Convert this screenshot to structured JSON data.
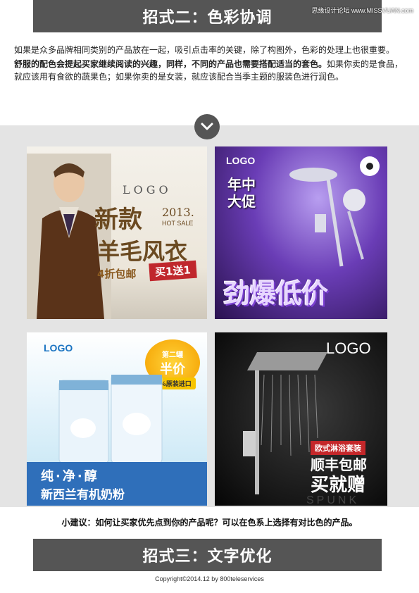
{
  "header": {
    "title": "招式二：色彩协调",
    "watermark": "思缘设计论坛 www.MISSVUAN.com"
  },
  "intro": {
    "para1": "如果是众多品牌相同类别的产品放在一起，吸引点击率的关键，除了构图外，色彩的处理上也很重要。",
    "para2_bold": "舒服的配色会提起买家继续阅读的兴趣，同样，不同的产品也需要搭配适当的套色。",
    "para2_rest": "如果你卖的是食品，就应该用有食欲的蔬果色；如果你卖的是女装，就应该配合当季主题的服装色进行润色。"
  },
  "icons": {
    "chevron": "chevron-down-icon"
  },
  "cards": {
    "coat": {
      "logo": "LOGO",
      "title1": "新款",
      "year": "2013.",
      "hot": "HOT SALE",
      "title2": "羊毛风衣",
      "promo": "4折包邮",
      "tag": "买1送1"
    },
    "shower_purple": {
      "logo": "LOGO",
      "headline": "年中大促",
      "burst": "劲爆低价"
    },
    "milk": {
      "logo": "LOGO",
      "badge_top": "第二罐",
      "badge_main": "半价",
      "ribbon": "100%原装进口",
      "line1": "纯·净·醇",
      "line2": "新西兰有机奶粉"
    },
    "shower_dark": {
      "logo": "LOGO",
      "label": "欧式淋浴套装",
      "line1": "顺丰包邮",
      "line2": "买就赠",
      "brand": "SPUNK"
    }
  },
  "tip": "小建议：如何让买家优先点到你的产品呢？可以在色系上选择有对比色的产品。",
  "footer_banner": {
    "title": "招式三：文字优化"
  },
  "copyright": "Copyright©2014.12 by 800teleservices"
}
